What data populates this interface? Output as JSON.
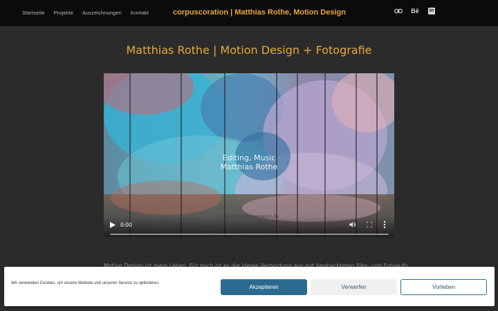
{
  "header": {
    "nav": [
      "Startseite",
      "Projekte",
      "Auszeichnungen",
      "Kontakt"
    ],
    "site_title": "corpuscoration | Matthias Rothe, Motion Design",
    "social": [
      {
        "name": "link-icon"
      },
      {
        "name": "behance-icon",
        "label": "Bē"
      },
      {
        "name": "linkedin-icon",
        "label": "in"
      }
    ]
  },
  "page_title": "Matthias Rothe | Motion Design + Fotografie",
  "video": {
    "overlay_line1": "Editing, Music",
    "overlay_line2": "Matthias Rothe",
    "copyright": "© 2023 corpuscoration.de",
    "time": "0:00",
    "progress": 0
  },
  "intro_text": "Motion Design ist mein Leben. Für mich ist es die ideale Verbindung aus gut beobachteten Film- und Fotoaufnahmen",
  "cookie": {
    "text": "Wir verwenden Cookies, um unsere Website und unseren Service zu optimieren.",
    "accept": "Akzeptieren",
    "deny": "Verwerfen",
    "prefs": "Vorlieben"
  },
  "colors": {
    "accent": "#e8a83a",
    "header_bg": "#0b0b0b",
    "page_bg": "#2b2b2b",
    "button_primary": "#2c6b8f"
  }
}
